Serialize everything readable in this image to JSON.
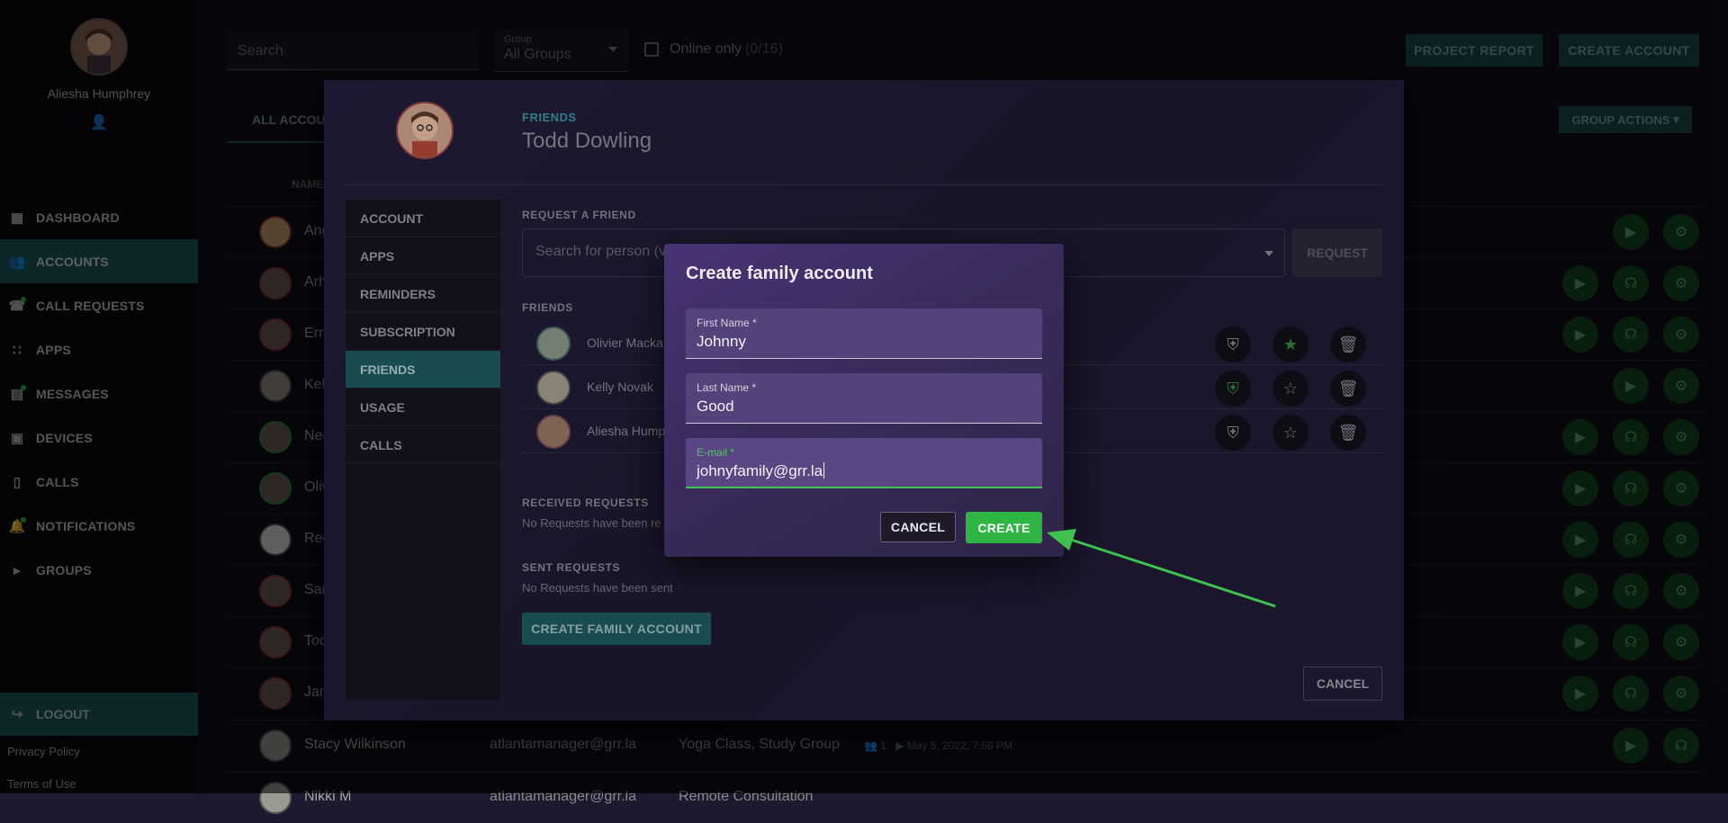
{
  "user": {
    "name": "Aliesha Humphrey"
  },
  "sidebar": {
    "items": [
      {
        "label": "DASHBOARD",
        "icon": "dashboard-icon"
      },
      {
        "label": "ACCOUNTS",
        "icon": "people-icon",
        "active": true
      },
      {
        "label": "CALL REQUESTS",
        "icon": "phone-icon",
        "dot": true
      },
      {
        "label": "APPS",
        "icon": "apps-grid-icon"
      },
      {
        "label": "MESSAGES",
        "icon": "message-icon",
        "dot": true
      },
      {
        "label": "DEVICES",
        "icon": "devices-icon"
      },
      {
        "label": "CALLS",
        "icon": "smartphone-icon"
      },
      {
        "label": "NOTIFICATIONS",
        "icon": "bell-icon",
        "dot": true
      },
      {
        "label": "GROUPS",
        "icon": "tag-icon"
      }
    ],
    "logout": "LOGOUT",
    "privacy": "Privacy Policy",
    "terms": "Terms of Use"
  },
  "toolbar": {
    "search_placeholder": "Search",
    "group_label": "Group",
    "group_value": "All Groups",
    "online_only": "Online only",
    "online_count": "(0/16)",
    "project_report": "PROJECT REPORT",
    "create_account": "CREATE ACCOUNT"
  },
  "tabs": {
    "all_accounts": "ALL ACCOUNTS"
  },
  "group_actions": "GROUP ACTIONS",
  "table": {
    "name_header": "NAME",
    "rows": [
      {
        "name": "Ange"
      },
      {
        "name": "Arhad"
      },
      {
        "name": "Ernes"
      },
      {
        "name": "Kelly"
      },
      {
        "name": "Neel"
      },
      {
        "name": "Olivie"
      },
      {
        "name": "Reev"
      },
      {
        "name": "Sami"
      },
      {
        "name": "Todd"
      },
      {
        "name": "Jan M"
      },
      {
        "name": "Stacy Wilkinson",
        "email": "atlantamanager@grr.la",
        "groups": "Yoga Class, Study Group",
        "meta": "1",
        "date": "May 5, 2022, 7:56 PM"
      },
      {
        "name": "Nikki M",
        "email": "atlantamanager@grr.la",
        "groups": "Remote Consultation"
      }
    ]
  },
  "friends_dialog": {
    "eyebrow": "FRIENDS",
    "title": "Todd Dowling",
    "menu": [
      "ACCOUNT",
      "APPS",
      "REMINDERS",
      "SUBSCRIPTION",
      "FRIENDS",
      "USAGE",
      "CALLS"
    ],
    "active_menu": "FRIENDS",
    "request_label": "REQUEST A FRIEND",
    "search_placeholder": "Search for person (v",
    "request_button": "REQUEST",
    "friends_label": "FRIENDS",
    "friends": [
      {
        "name": "Olivier Macka",
        "shield": "outline",
        "star": "filled"
      },
      {
        "name": "Kelly Novak",
        "shield": "filled",
        "star": "outline"
      },
      {
        "name": "Aliesha Hump",
        "shield": "outline",
        "star": "outline"
      }
    ],
    "received_label": "RECEIVED REQUESTS",
    "received_note": "No Requests have been re",
    "sent_label": "SENT REQUESTS",
    "sent_note": "No Requests have been sent",
    "create_family": "CREATE FAMILY ACCOUNT",
    "cancel": "CANCEL"
  },
  "modal": {
    "title": "Create family account",
    "first_name_label": "First Name *",
    "first_name_value": "Johnny",
    "last_name_label": "Last Name *",
    "last_name_value": "Good",
    "email_label": "E-mail *",
    "email_value": "johnyfamily@grr.la",
    "cancel": "CANCEL",
    "create": "CREATE"
  },
  "colors": {
    "accent_teal": "#1f5d63",
    "create_green": "#2fb544",
    "arrow_green": "#3ec24f",
    "modal_bg": "#3a2b5c"
  }
}
